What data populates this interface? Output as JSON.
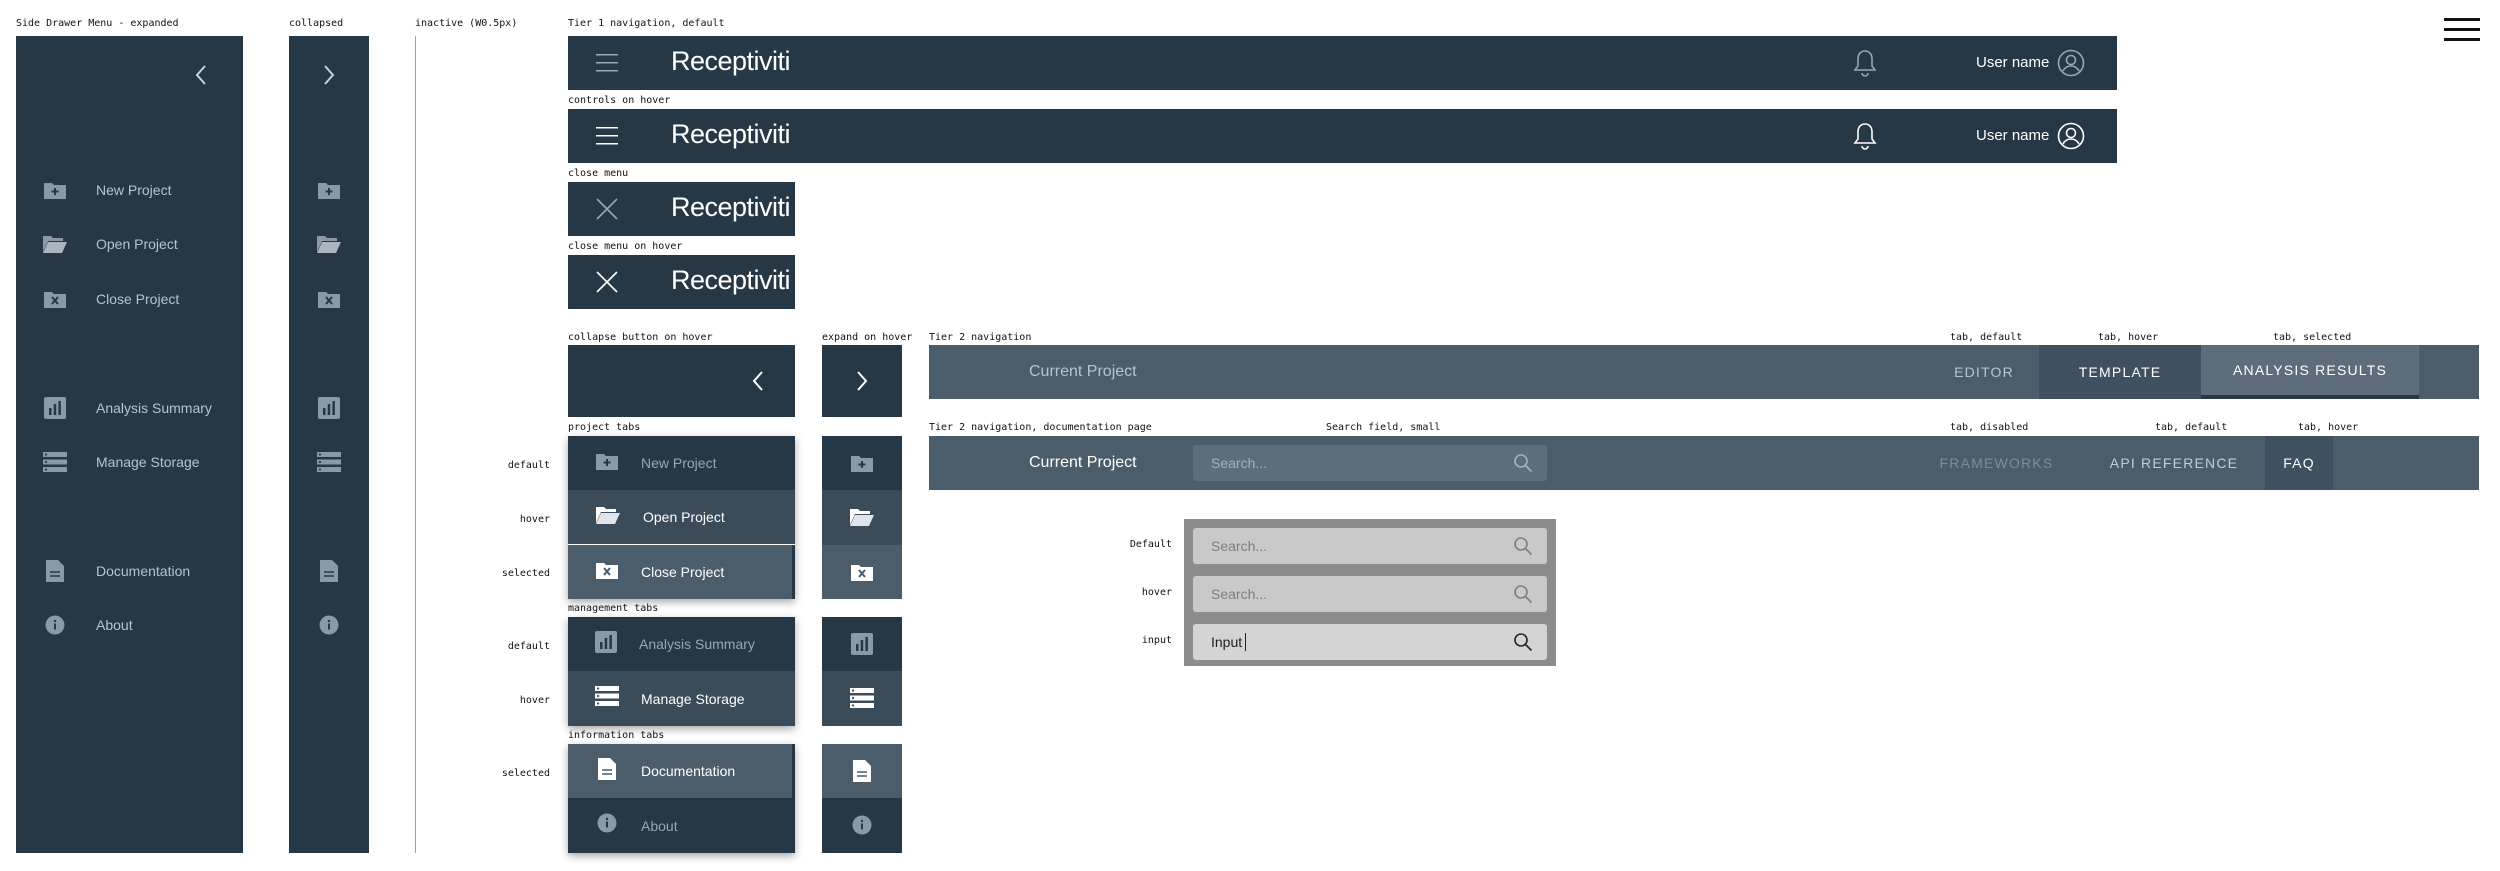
{
  "captions": {
    "drawer_expanded": "Side Drawer Menu - expanded",
    "collapsed": "collapsed",
    "inactive": "inactive (W0.5px)",
    "tier1_default": "Tier 1 navigation, default",
    "controls_hover": "controls on hover",
    "close_menu": "close menu",
    "close_menu_hover": "close menu on hover",
    "collapse_hover": "collapse button on hover",
    "expand_hover": "expand on hover",
    "project_tabs": "project tabs",
    "management_tabs": "management tabs",
    "information_tabs": "information tabs",
    "tier2": "Tier 2 navigation",
    "tab_default": "tab, default",
    "tab_hover": "tab, hover",
    "tab_selected": "tab, selected",
    "tier2_doc": "Tier 2 navigation, documentation page",
    "search_small": "Search field, small",
    "tab_disabled": "tab, disabled",
    "tab_default2": "tab, default",
    "tab_hover2": "tab, hover"
  },
  "state_labels": {
    "default": "default",
    "hover": "hover",
    "selected": "selected",
    "default2": "default",
    "hover2": "hover",
    "selected2": "selected",
    "search_default": "Default",
    "search_hover": "hover",
    "search_input": "input"
  },
  "menu": {
    "new_project": "New Project",
    "open_project": "Open Project",
    "close_project": "Close Project",
    "analysis_summary": "Analysis Summary",
    "manage_storage": "Manage Storage",
    "documentation": "Documentation",
    "about": "About"
  },
  "nav": {
    "brand": "Receptiviti",
    "user_name": "User name"
  },
  "tier2": {
    "title": "Current Project",
    "tab_editor": "EDITOR",
    "tab_template": "TEMPLATE",
    "tab_analysis": "ANALYSIS RESULTS",
    "tab_frameworks": "FRAMEWORKS",
    "tab_api": "API REFERENCE",
    "tab_faq": "FAQ"
  },
  "search": {
    "placeholder": "Search...",
    "input_value": "Input"
  },
  "colors": {
    "dark": "#263746",
    "mid": "#4b5c6b",
    "hover": "#3a4b5a",
    "selected": "#4b5c6b",
    "text_muted": "#b8c3cd",
    "accent_line": "#263746"
  }
}
